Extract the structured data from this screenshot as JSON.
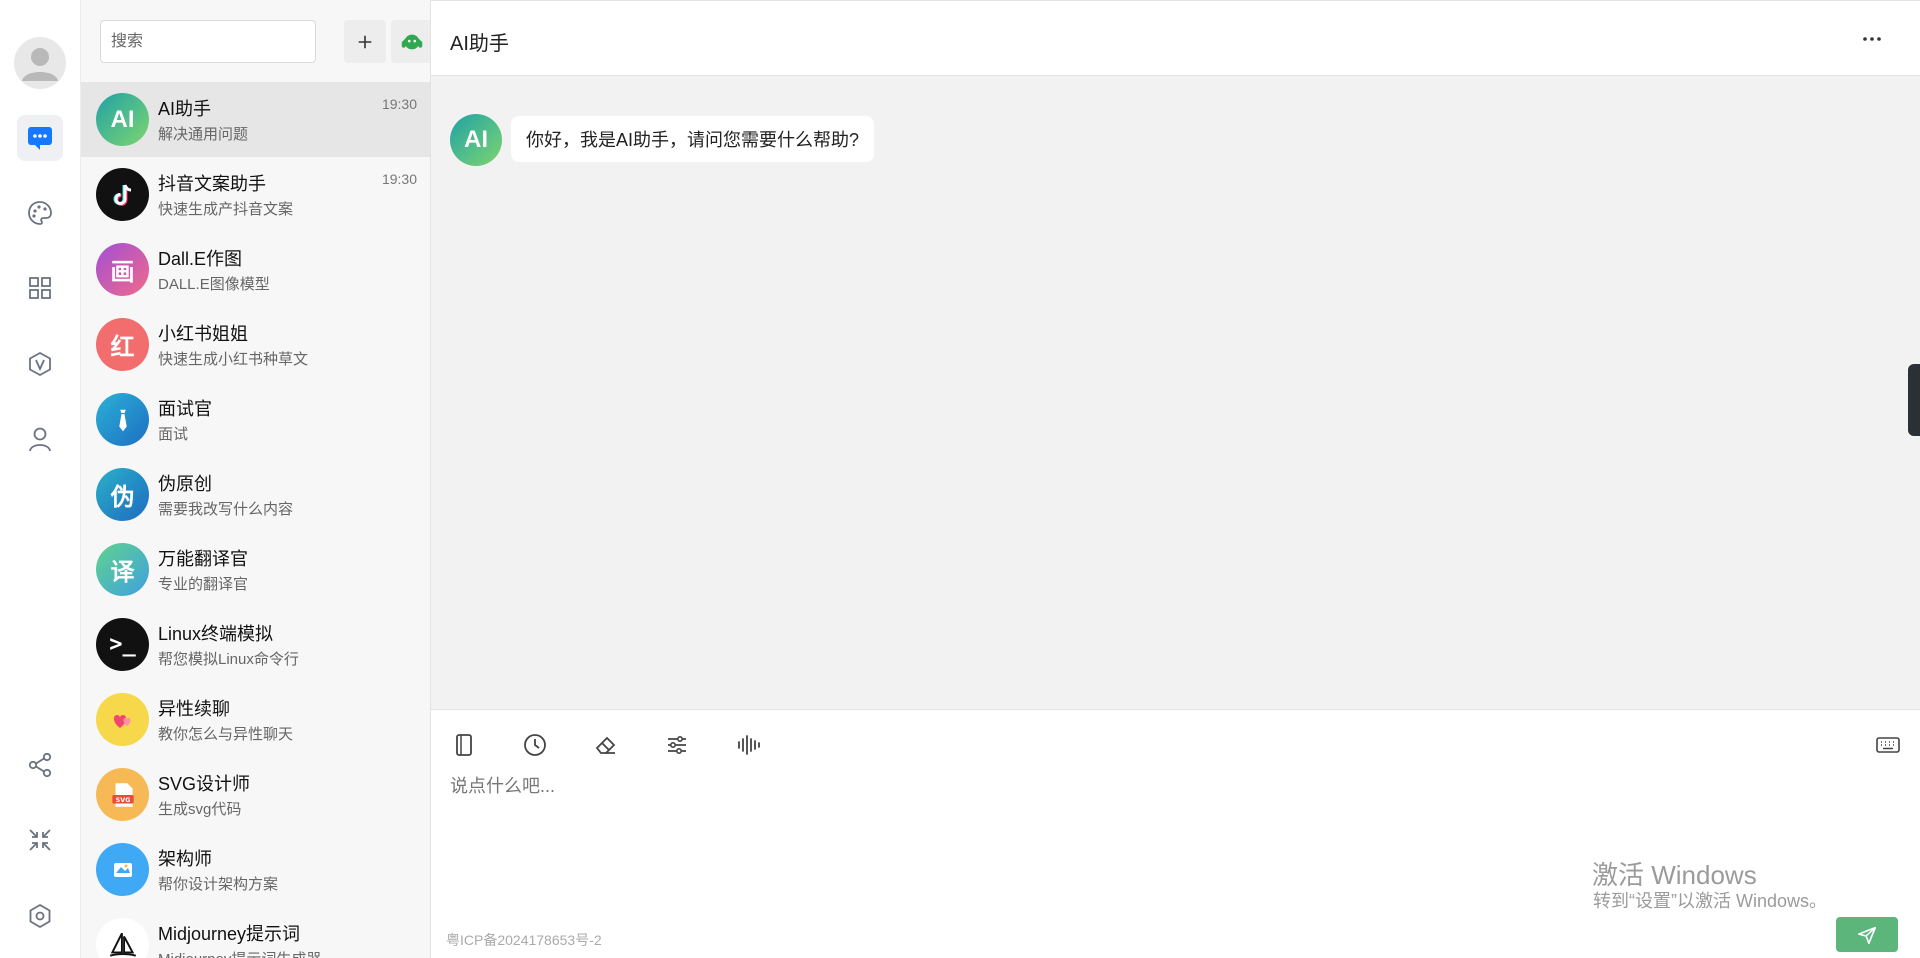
{
  "colors": {
    "accent_blue": "#1677ff",
    "send_green": "#5cb57a",
    "chat_bg": "#f2f2f2",
    "list_bg": "#f7f7f7"
  },
  "rail": {
    "icons": [
      "avatar-icon",
      "chat-icon",
      "palette-icon",
      "apps-grid-icon",
      "v-badge-icon",
      "user-icon",
      "share-icon",
      "collapse-icon",
      "settings-icon"
    ]
  },
  "search": {
    "placeholder": "搜索",
    "add_icon": "plus-icon",
    "support_icon": "support-agent-icon"
  },
  "conversations": [
    {
      "title": "AI助手",
      "subtitle": "解决通用问题",
      "time": "19:30",
      "avatar_text": "AI"
    },
    {
      "title": "抖音文案助手",
      "subtitle": "快速生成产抖音文案",
      "time": "19:30",
      "avatar_text": ""
    },
    {
      "title": "Dall.E作图",
      "subtitle": "DALL.E图像模型",
      "time": "",
      "avatar_text": "画"
    },
    {
      "title": "小红书姐姐",
      "subtitle": "快速生成小红书种草文",
      "time": "",
      "avatar_text": "红"
    },
    {
      "title": "面试官",
      "subtitle": "面试",
      "time": "",
      "avatar_text": ""
    },
    {
      "title": "伪原创",
      "subtitle": "需要我改写什么内容",
      "time": "",
      "avatar_text": "伪"
    },
    {
      "title": "万能翻译官",
      "subtitle": "专业的翻译官",
      "time": "",
      "avatar_text": "译"
    },
    {
      "title": "Linux终端模拟",
      "subtitle": "帮您模拟Linux命令行",
      "time": "",
      "avatar_text": ">_"
    },
    {
      "title": "异性续聊",
      "subtitle": "教你怎么与异性聊天",
      "time": "",
      "avatar_text": ""
    },
    {
      "title": "SVG设计师",
      "subtitle": "生成svg代码",
      "time": "",
      "avatar_text": "SVG"
    },
    {
      "title": "架构师",
      "subtitle": "帮你设计架构方案",
      "time": "",
      "avatar_text": ""
    },
    {
      "title": "Midjourney提示词",
      "subtitle": "Midjourney提示词生成器",
      "time": "",
      "avatar_text": ""
    }
  ],
  "chat": {
    "title": "AI助手",
    "more_icon": "more-horizontal-icon",
    "messages": [
      {
        "avatar_text": "AI",
        "text": "你好，我是AI助手，请问您需要什么帮助?"
      }
    ]
  },
  "composer": {
    "placeholder": "说点什么吧...",
    "tools": [
      "notebook-icon",
      "history-icon",
      "eraser-icon",
      "sliders-icon",
      "voice-wave-icon"
    ],
    "keyboard_icon": "keyboard-icon",
    "send_icon": "send-icon",
    "icp": "粤ICP备2024178653号-2"
  },
  "watermark": {
    "line1": "激活 Windows",
    "line2": "转到“设置”以激活 Windows。"
  }
}
